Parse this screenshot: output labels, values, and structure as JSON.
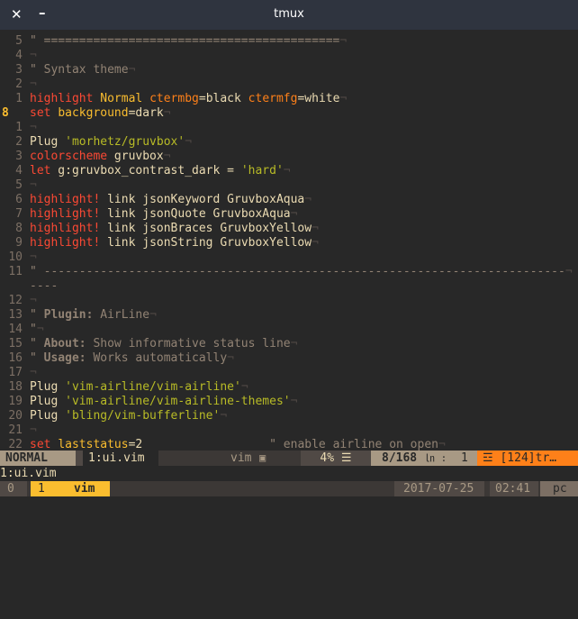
{
  "window": {
    "title": "tmux",
    "close_glyph": "✕",
    "min_glyph": "–"
  },
  "nontext": "¬",
  "lines": [
    {
      "num": "5",
      "cls": "c-com",
      "text": "\" =========================================="
    },
    {
      "num": "4",
      "cls": "",
      "text": ""
    },
    {
      "num": "3",
      "cls": "c-com",
      "text": "\" Syntax theme"
    },
    {
      "num": "2",
      "cls": "",
      "text": ""
    },
    {
      "num": "1",
      "parts": [
        [
          "c-kw",
          "highlight"
        ],
        [
          "",
          " "
        ],
        [
          "c-id",
          "Normal"
        ],
        [
          "",
          " "
        ],
        [
          "c-fn",
          "ctermbg"
        ],
        [
          "",
          "=black "
        ],
        [
          "c-fn",
          "ctermfg"
        ],
        [
          "",
          "=white"
        ]
      ]
    },
    {
      "num": "8",
      "cur": true,
      "parts": [
        [
          "c-kw",
          "set"
        ],
        [
          "",
          " "
        ],
        [
          "c-id",
          "background"
        ],
        [
          "",
          "=dark"
        ]
      ]
    },
    {
      "num": "1",
      "cls": "",
      "text": ""
    },
    {
      "num": "2",
      "parts": [
        [
          "",
          "Plug "
        ],
        [
          "c-str",
          "'morhetz/gruvbox'"
        ]
      ]
    },
    {
      "num": "3",
      "parts": [
        [
          "c-kw",
          "colorscheme"
        ],
        [
          "",
          " gruvbox"
        ]
      ]
    },
    {
      "num": "4",
      "parts": [
        [
          "c-kw",
          "let"
        ],
        [
          "",
          " g:gruvbox_contrast_dark = "
        ],
        [
          "c-str",
          "'hard'"
        ]
      ]
    },
    {
      "num": "5",
      "cls": "",
      "text": ""
    },
    {
      "num": "6",
      "parts": [
        [
          "c-kw",
          "highlight!"
        ],
        [
          "",
          " link jsonKeyword GruvboxAqua"
        ]
      ]
    },
    {
      "num": "7",
      "parts": [
        [
          "c-kw",
          "highlight!"
        ],
        [
          "",
          " link jsonQuote GruvboxAqua"
        ]
      ]
    },
    {
      "num": "8",
      "parts": [
        [
          "c-kw",
          "highlight!"
        ],
        [
          "",
          " link jsonBraces GruvboxYellow"
        ]
      ]
    },
    {
      "num": "9",
      "parts": [
        [
          "c-kw",
          "highlight!"
        ],
        [
          "",
          " link jsonString GruvboxYellow"
        ]
      ]
    },
    {
      "num": "10",
      "cls": "",
      "text": ""
    },
    {
      "num": "11",
      "cls": "c-com",
      "text": "\" --------------------------------------------------------------------------"
    },
    {
      "num": "",
      "wrapped": true,
      "cls": "c-com",
      "text": "----"
    },
    {
      "num": "12",
      "cls": "",
      "text": ""
    },
    {
      "num": "13",
      "parts": [
        [
          "c-com",
          "\" "
        ],
        [
          "c-comb",
          "Plugin:"
        ],
        [
          "c-com",
          " AirLine"
        ]
      ]
    },
    {
      "num": "14",
      "cls": "c-com",
      "text": "\""
    },
    {
      "num": "15",
      "parts": [
        [
          "c-com",
          "\" "
        ],
        [
          "c-comb",
          "About:"
        ],
        [
          "c-com",
          " Show informative status line"
        ]
      ]
    },
    {
      "num": "16",
      "parts": [
        [
          "c-com",
          "\" "
        ],
        [
          "c-comb",
          "Usage:"
        ],
        [
          "c-com",
          " Works automatically"
        ]
      ]
    },
    {
      "num": "17",
      "cls": "",
      "text": ""
    },
    {
      "num": "18",
      "parts": [
        [
          "",
          "Plug "
        ],
        [
          "c-str",
          "'vim-airline/vim-airline'"
        ]
      ]
    },
    {
      "num": "19",
      "parts": [
        [
          "",
          "Plug "
        ],
        [
          "c-str",
          "'vim-airline/vim-airline-themes'"
        ]
      ]
    },
    {
      "num": "20",
      "parts": [
        [
          "",
          "Plug "
        ],
        [
          "c-str",
          "'bling/vim-bufferline'"
        ]
      ]
    },
    {
      "num": "21",
      "cls": "",
      "text": ""
    },
    {
      "num": "22",
      "parts": [
        [
          "c-kw",
          "set"
        ],
        [
          "",
          " "
        ],
        [
          "c-id",
          "laststatus"
        ],
        [
          "",
          "=2                  "
        ],
        [
          "c-com",
          "\" enable airline on open"
        ]
      ]
    }
  ],
  "statusline": {
    "mode": "NORMAL",
    "buffer": "1:ui.vim",
    "filetype": "vim",
    "percent": "4% ☰",
    "position": "8/168",
    "col_sep": "㏑ :",
    "col": "1",
    "warning": "☲ [124]tr…"
  },
  "cmdline": "1:ui.vim",
  "tmux": {
    "session": "0",
    "window": "1",
    "name": "vim",
    "date": "2017-07-25",
    "time": "02:41",
    "host": "pc"
  },
  "colors": {
    "bg": "#282828",
    "fg": "#ebdbb2",
    "comment": "#928374",
    "keyword": "#fb4934",
    "string": "#b8bb26",
    "yellow": "#fabd2f",
    "orange": "#fe8019"
  }
}
